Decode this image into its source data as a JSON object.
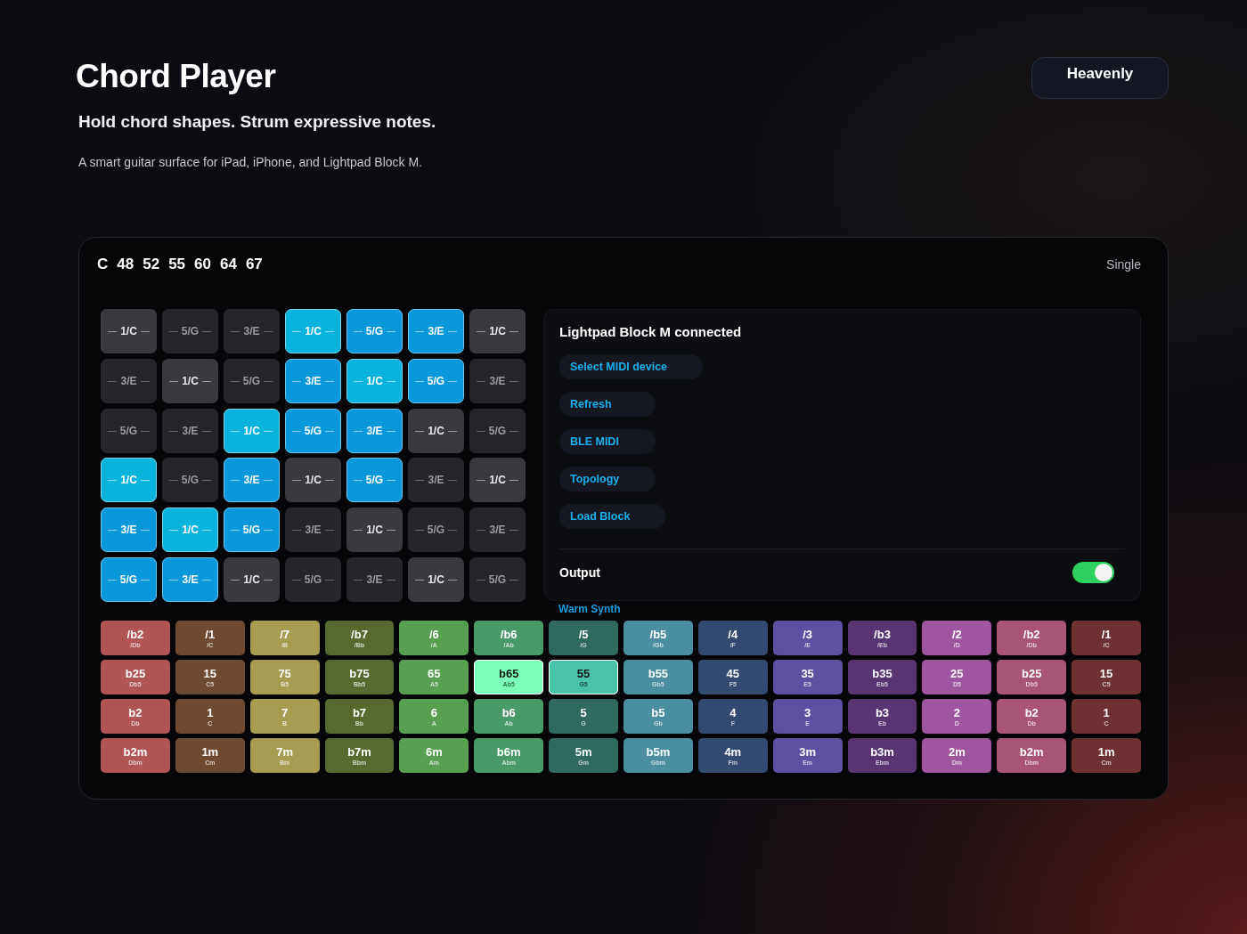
{
  "header": {
    "title": "Chord Player",
    "subtitle": "Hold chord shapes. Strum expressive notes.",
    "description": "A smart guitar surface for iPad, iPhone, and Lightpad Block M.",
    "preset_button": "Heavenly"
  },
  "player": {
    "root": "C",
    "notes": [
      "48",
      "52",
      "55",
      "60",
      "64",
      "67"
    ],
    "mode": "Single",
    "pads": [
      [
        {
          "label": "1/C",
          "lit": false,
          "root": true
        },
        {
          "label": "5/G",
          "lit": false,
          "root": false
        },
        {
          "label": "3/E",
          "lit": false,
          "root": false
        },
        {
          "label": "1/C",
          "lit": true,
          "root": true
        },
        {
          "label": "5/G",
          "lit": true,
          "root": false
        },
        {
          "label": "3/E",
          "lit": true,
          "root": false
        },
        {
          "label": "1/C",
          "lit": false,
          "root": true
        }
      ],
      [
        {
          "label": "3/E",
          "lit": false,
          "root": false
        },
        {
          "label": "1/C",
          "lit": false,
          "root": true
        },
        {
          "label": "5/G",
          "lit": false,
          "root": false
        },
        {
          "label": "3/E",
          "lit": true,
          "root": false
        },
        {
          "label": "1/C",
          "lit": true,
          "root": true
        },
        {
          "label": "5/G",
          "lit": true,
          "root": false
        },
        {
          "label": "3/E",
          "lit": false,
          "root": false
        }
      ],
      [
        {
          "label": "5/G",
          "lit": false,
          "root": false
        },
        {
          "label": "3/E",
          "lit": false,
          "root": false
        },
        {
          "label": "1/C",
          "lit": true,
          "root": true
        },
        {
          "label": "5/G",
          "lit": true,
          "root": false
        },
        {
          "label": "3/E",
          "lit": true,
          "root": false
        },
        {
          "label": "1/C",
          "lit": false,
          "root": true
        },
        {
          "label": "5/G",
          "lit": false,
          "root": false
        }
      ],
      [
        {
          "label": "1/C",
          "lit": true,
          "root": true
        },
        {
          "label": "5/G",
          "lit": false,
          "root": false
        },
        {
          "label": "3/E",
          "lit": true,
          "root": false
        },
        {
          "label": "1/C",
          "lit": false,
          "root": true
        },
        {
          "label": "5/G",
          "lit": true,
          "root": false
        },
        {
          "label": "3/E",
          "lit": false,
          "root": false
        },
        {
          "label": "1/C",
          "lit": false,
          "root": true
        }
      ],
      [
        {
          "label": "3/E",
          "lit": true,
          "root": false
        },
        {
          "label": "1/C",
          "lit": true,
          "root": true
        },
        {
          "label": "5/G",
          "lit": true,
          "root": false
        },
        {
          "label": "3/E",
          "lit": false,
          "root": false
        },
        {
          "label": "1/C",
          "lit": false,
          "root": true
        },
        {
          "label": "5/G",
          "lit": false,
          "root": false
        },
        {
          "label": "3/E",
          "lit": false,
          "root": false
        }
      ],
      [
        {
          "label": "5/G",
          "lit": true,
          "root": false
        },
        {
          "label": "3/E",
          "lit": true,
          "root": false
        },
        {
          "label": "1/C",
          "lit": false,
          "root": true
        },
        {
          "label": "5/G",
          "lit": false,
          "root": false
        },
        {
          "label": "3/E",
          "lit": false,
          "root": false
        },
        {
          "label": "1/C",
          "lit": false,
          "root": true
        },
        {
          "label": "5/G",
          "lit": false,
          "root": false
        }
      ]
    ],
    "device_panel": {
      "status": "Lightpad Block M connected",
      "buttons": [
        "Select MIDI device",
        "Refresh",
        "BLE MIDI",
        "Topology",
        "Load Block"
      ],
      "output": {
        "label": "Output",
        "on": true
      },
      "sound": "Warm Synth"
    },
    "chord_columns": [
      {
        "color": "#b05454",
        "cells": [
          {
            "main": "/b2",
            "sub": "/Db",
            "selected": false
          },
          {
            "main": "b25",
            "sub": "Db5",
            "selected": false
          },
          {
            "main": "b2",
            "sub": "Db",
            "selected": false
          },
          {
            "main": "b2m",
            "sub": "Dbm",
            "selected": false
          }
        ]
      },
      {
        "color": "#6e4a30",
        "cells": [
          {
            "main": "/1",
            "sub": "/C",
            "selected": false
          },
          {
            "main": "15",
            "sub": "C5",
            "selected": false
          },
          {
            "main": "1",
            "sub": "C",
            "selected": false
          },
          {
            "main": "1m",
            "sub": "Cm",
            "selected": false
          }
        ]
      },
      {
        "color": "#a89c52",
        "cells": [
          {
            "main": "/7",
            "sub": "/B",
            "selected": false
          },
          {
            "main": "75",
            "sub": "B5",
            "selected": false
          },
          {
            "main": "7",
            "sub": "B",
            "selected": false
          },
          {
            "main": "7m",
            "sub": "Bm",
            "selected": false
          }
        ]
      },
      {
        "color": "#566a30",
        "cells": [
          {
            "main": "/b7",
            "sub": "/Bb",
            "selected": false
          },
          {
            "main": "b75",
            "sub": "Bb5",
            "selected": false
          },
          {
            "main": "b7",
            "sub": "Bb",
            "selected": false
          },
          {
            "main": "b7m",
            "sub": "Bbm",
            "selected": false
          }
        ]
      },
      {
        "color": "#56a050",
        "cells": [
          {
            "main": "/6",
            "sub": "/A",
            "selected": false
          },
          {
            "main": "65",
            "sub": "A5",
            "selected": false
          },
          {
            "main": "6",
            "sub": "A",
            "selected": false
          },
          {
            "main": "6m",
            "sub": "Am",
            "selected": false
          }
        ]
      },
      {
        "color": "#4a9a68",
        "cells": [
          {
            "main": "/b6",
            "sub": "/Ab",
            "selected": false
          },
          {
            "main": "b65",
            "sub": "Ab5",
            "selected": true
          },
          {
            "main": "b6",
            "sub": "Ab",
            "selected": false
          },
          {
            "main": "b6m",
            "sub": "Abm",
            "selected": false
          }
        ]
      },
      {
        "color": "#2e6a5e",
        "cells": [
          {
            "main": "/5",
            "sub": "/G",
            "selected": false
          },
          {
            "main": "55",
            "sub": "G5",
            "selected": true
          },
          {
            "main": "5",
            "sub": "G",
            "selected": false
          },
          {
            "main": "5m",
            "sub": "Gm",
            "selected": false
          }
        ]
      },
      {
        "color": "#4a8ea0",
        "cells": [
          {
            "main": "/b5",
            "sub": "/Gb",
            "selected": false
          },
          {
            "main": "b55",
            "sub": "Gb5",
            "selected": false
          },
          {
            "main": "b5",
            "sub": "Gb",
            "selected": false
          },
          {
            "main": "b5m",
            "sub": "Gbm",
            "selected": false
          }
        ]
      },
      {
        "color": "#334a70",
        "cells": [
          {
            "main": "/4",
            "sub": "/F",
            "selected": false
          },
          {
            "main": "45",
            "sub": "F5",
            "selected": false
          },
          {
            "main": "4",
            "sub": "F",
            "selected": false
          },
          {
            "main": "4m",
            "sub": "Fm",
            "selected": false
          }
        ]
      },
      {
        "color": "#5c50a0",
        "cells": [
          {
            "main": "/3",
            "sub": "/E",
            "selected": false
          },
          {
            "main": "35",
            "sub": "E5",
            "selected": false
          },
          {
            "main": "3",
            "sub": "E",
            "selected": false
          },
          {
            "main": "3m",
            "sub": "Em",
            "selected": false
          }
        ]
      },
      {
        "color": "#5a3470",
        "cells": [
          {
            "main": "/b3",
            "sub": "/Eb",
            "selected": false
          },
          {
            "main": "b35",
            "sub": "Eb5",
            "selected": false
          },
          {
            "main": "b3",
            "sub": "Eb",
            "selected": false
          },
          {
            "main": "b3m",
            "sub": "Ebm",
            "selected": false
          }
        ]
      },
      {
        "color": "#a0569e",
        "cells": [
          {
            "main": "/2",
            "sub": "/D",
            "selected": false
          },
          {
            "main": "25",
            "sub": "D5",
            "selected": false
          },
          {
            "main": "2",
            "sub": "D",
            "selected": false
          },
          {
            "main": "2m",
            "sub": "Dm",
            "selected": false
          }
        ]
      },
      {
        "color": "#a85474",
        "cells": [
          {
            "main": "/b2",
            "sub": "/Db",
            "selected": false
          },
          {
            "main": "b25",
            "sub": "Db5",
            "selected": false
          },
          {
            "main": "b2",
            "sub": "Db",
            "selected": false
          },
          {
            "main": "b2m",
            "sub": "Dbm",
            "selected": false
          }
        ]
      },
      {
        "color": "#6e3030",
        "cells": [
          {
            "main": "/1",
            "sub": "/C",
            "selected": false
          },
          {
            "main": "15",
            "sub": "C5",
            "selected": false
          },
          {
            "main": "1",
            "sub": "C",
            "selected": false
          },
          {
            "main": "1m",
            "sub": "Cm",
            "selected": false
          }
        ]
      }
    ]
  }
}
